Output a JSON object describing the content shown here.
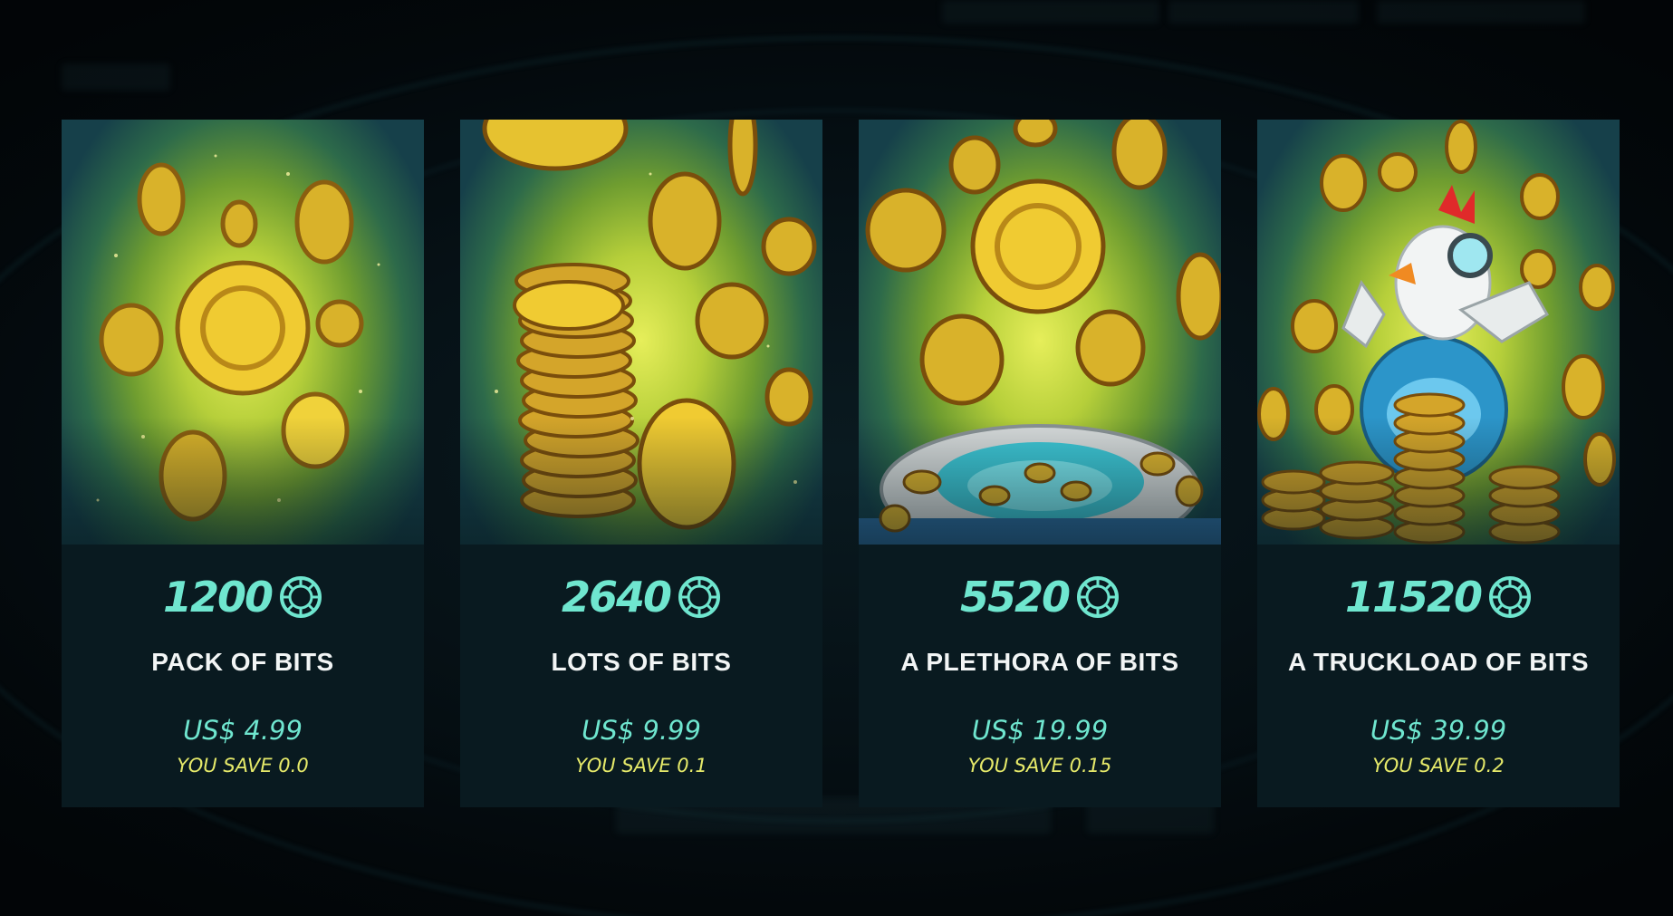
{
  "colors": {
    "accent": "#6fe6cf",
    "save": "#e6ea6a",
    "card_bg": "#091a20",
    "title": "#f2f5f5"
  },
  "currency_icon": "bits-coin-icon",
  "packs": [
    {
      "amount": "1200",
      "name": "PACK OF BITS",
      "price": "US$ 4.99",
      "save": "YOU SAVE 0.0"
    },
    {
      "amount": "2640",
      "name": "LOTS OF BITS",
      "price": "US$ 9.99",
      "save": "YOU SAVE 0.1"
    },
    {
      "amount": "5520",
      "name": "A PLETHORA OF BITS",
      "price": "US$ 19.99",
      "save": "YOU SAVE 0.15"
    },
    {
      "amount": "11520",
      "name": "A TRUCKLOAD OF BITS",
      "price": "US$ 39.99",
      "save": "YOU SAVE 0.2"
    }
  ]
}
